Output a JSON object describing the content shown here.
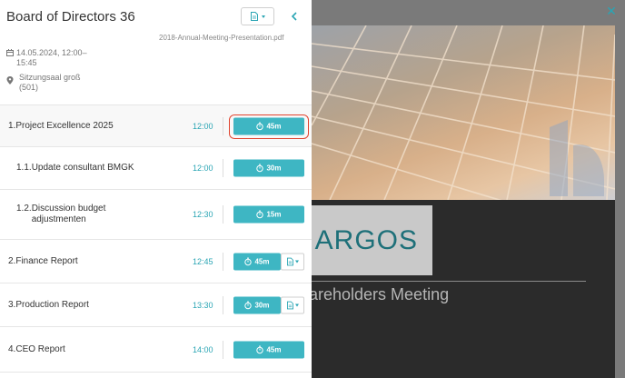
{
  "meeting": {
    "title": "Board of Directors 36",
    "datetime": "14.05.2024, 12:00–15:45",
    "location": "Sitzungsaal groß (501)",
    "file_name": "2018-Annual-Meeting-Presentation.pdf"
  },
  "agenda": [
    {
      "number": "1.",
      "title": "Project Excellence 2025",
      "time": "12:00",
      "duration": "45m",
      "has_document": false,
      "highlighted": true
    },
    {
      "number": "1.1.",
      "title": "Update consultant BMGK",
      "time": "12:00",
      "duration": "30m",
      "has_document": false
    },
    {
      "number": "1.2.",
      "title": "Discussion budget adjustmenten",
      "time": "12:30",
      "duration": "15m",
      "has_document": false
    },
    {
      "number": "2.",
      "title": "Finance Report",
      "time": "12:45",
      "duration": "45m",
      "has_document": true
    },
    {
      "number": "3.",
      "title": "Production Report",
      "time": "13:30",
      "duration": "30m",
      "has_document": true
    },
    {
      "number": "4.",
      "title": "CEO Report",
      "time": "14:00",
      "duration": "45m",
      "has_document": false
    }
  ],
  "presentation": {
    "logo_text": "ARGOS",
    "caption": "areholders Meeting"
  },
  "icons": {
    "document": "document-icon",
    "calendar": "calendar-icon",
    "location": "location-pin-icon",
    "back": "chevron-left-icon",
    "timer": "stopwatch-icon",
    "close": "close-icon"
  },
  "colors": {
    "accent": "#3eb6c3",
    "time_text": "#2aa5b4",
    "highlight": "#e0442f"
  }
}
